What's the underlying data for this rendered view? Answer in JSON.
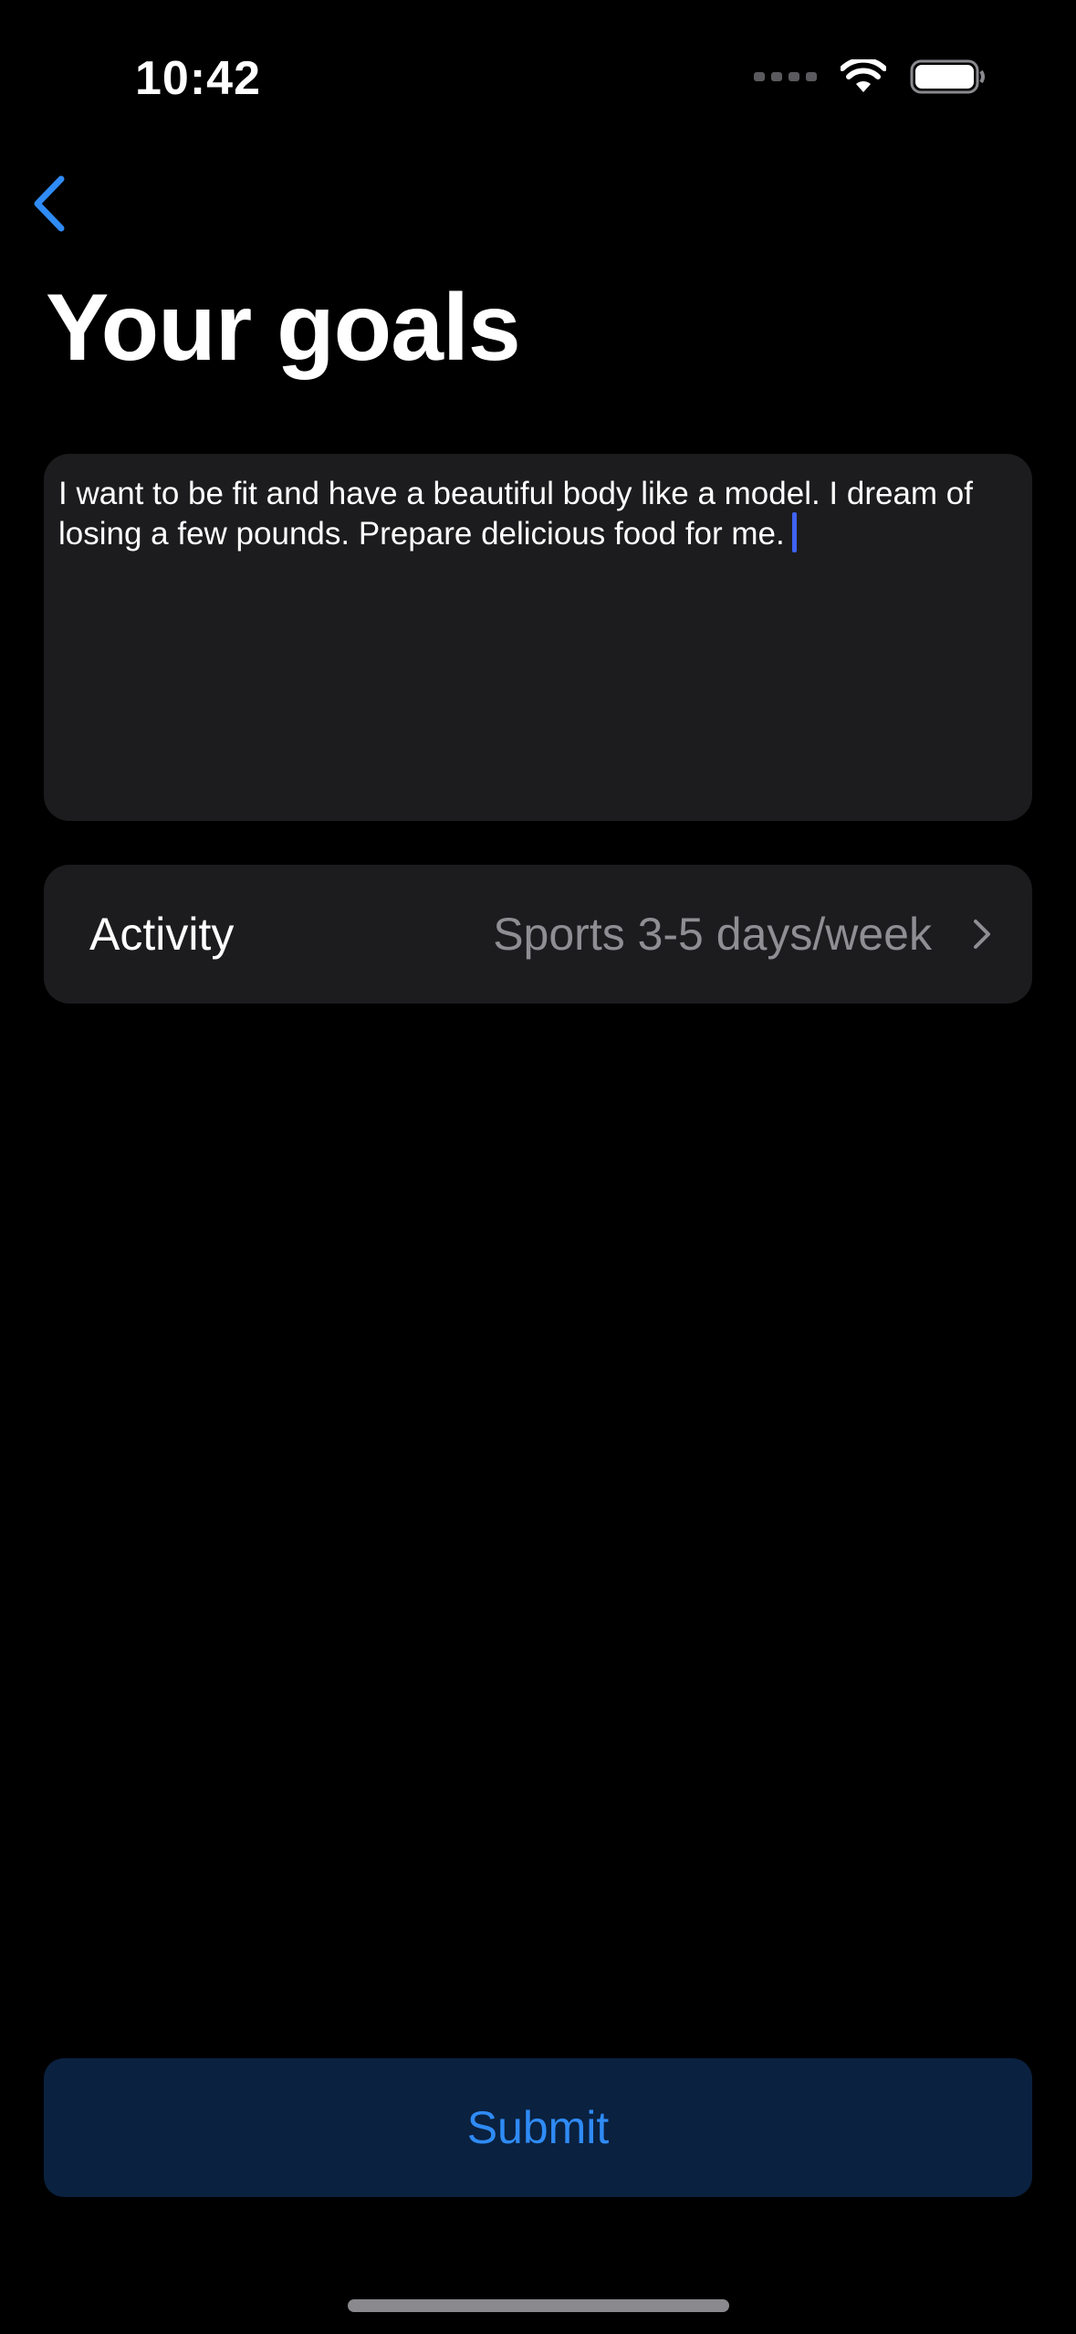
{
  "status_bar": {
    "time": "10:42",
    "wifi_icon": "wifi-icon",
    "battery_icon": "battery-icon"
  },
  "nav": {
    "back_icon": "chevron-left-icon"
  },
  "header": {
    "title": "Your goals"
  },
  "goals": {
    "text": "I want to be fit and have a beautiful body like a model. I dream of losing a few pounds. Prepare delicious food for me."
  },
  "activity": {
    "label": "Activity",
    "value": "Sports 3-5 days/week",
    "icon": "chevron-right-icon"
  },
  "footer": {
    "submit_label": "Submit"
  },
  "colors": {
    "background": "#000000",
    "card": "#1c1c1e",
    "accent": "#2f8bf5",
    "submit_bg": "#0a2140",
    "secondary_text": "#8e8e93",
    "cursor": "#3f63f2"
  }
}
